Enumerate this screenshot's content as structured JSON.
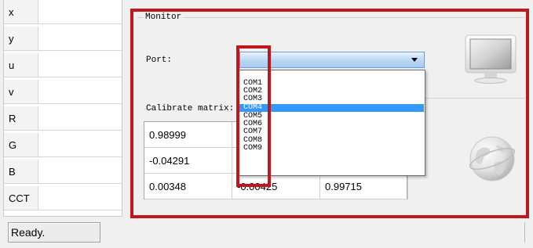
{
  "left_table": {
    "rows": [
      {
        "label": "x"
      },
      {
        "label": "y"
      },
      {
        "label": "u"
      },
      {
        "label": "v"
      },
      {
        "label": "R"
      },
      {
        "label": "G"
      },
      {
        "label": "B"
      },
      {
        "label": "CCT"
      }
    ]
  },
  "monitor": {
    "group_title": "Monitor",
    "port_label": "Port:",
    "port_value": "",
    "port_options": [
      "COM1",
      "COM2",
      "COM3",
      "COM4",
      "COM5",
      "COM6",
      "COM7",
      "COM8",
      "COM9"
    ],
    "selected_option": "COM4"
  },
  "calibrate": {
    "label": "Calibrate matrix:",
    "matrix": [
      [
        "0.98999",
        "",
        ""
      ],
      [
        "-0.04291",
        "",
        ""
      ],
      [
        "0.00348",
        "-0.00425",
        "0.99715"
      ]
    ]
  },
  "status": {
    "text": "Ready."
  },
  "icons": {
    "monitor": "monitor-icon",
    "globe": "globe-icon"
  },
  "colors": {
    "highlight_frame": "#c0171e",
    "selected_option_bg": "#3399ff"
  }
}
